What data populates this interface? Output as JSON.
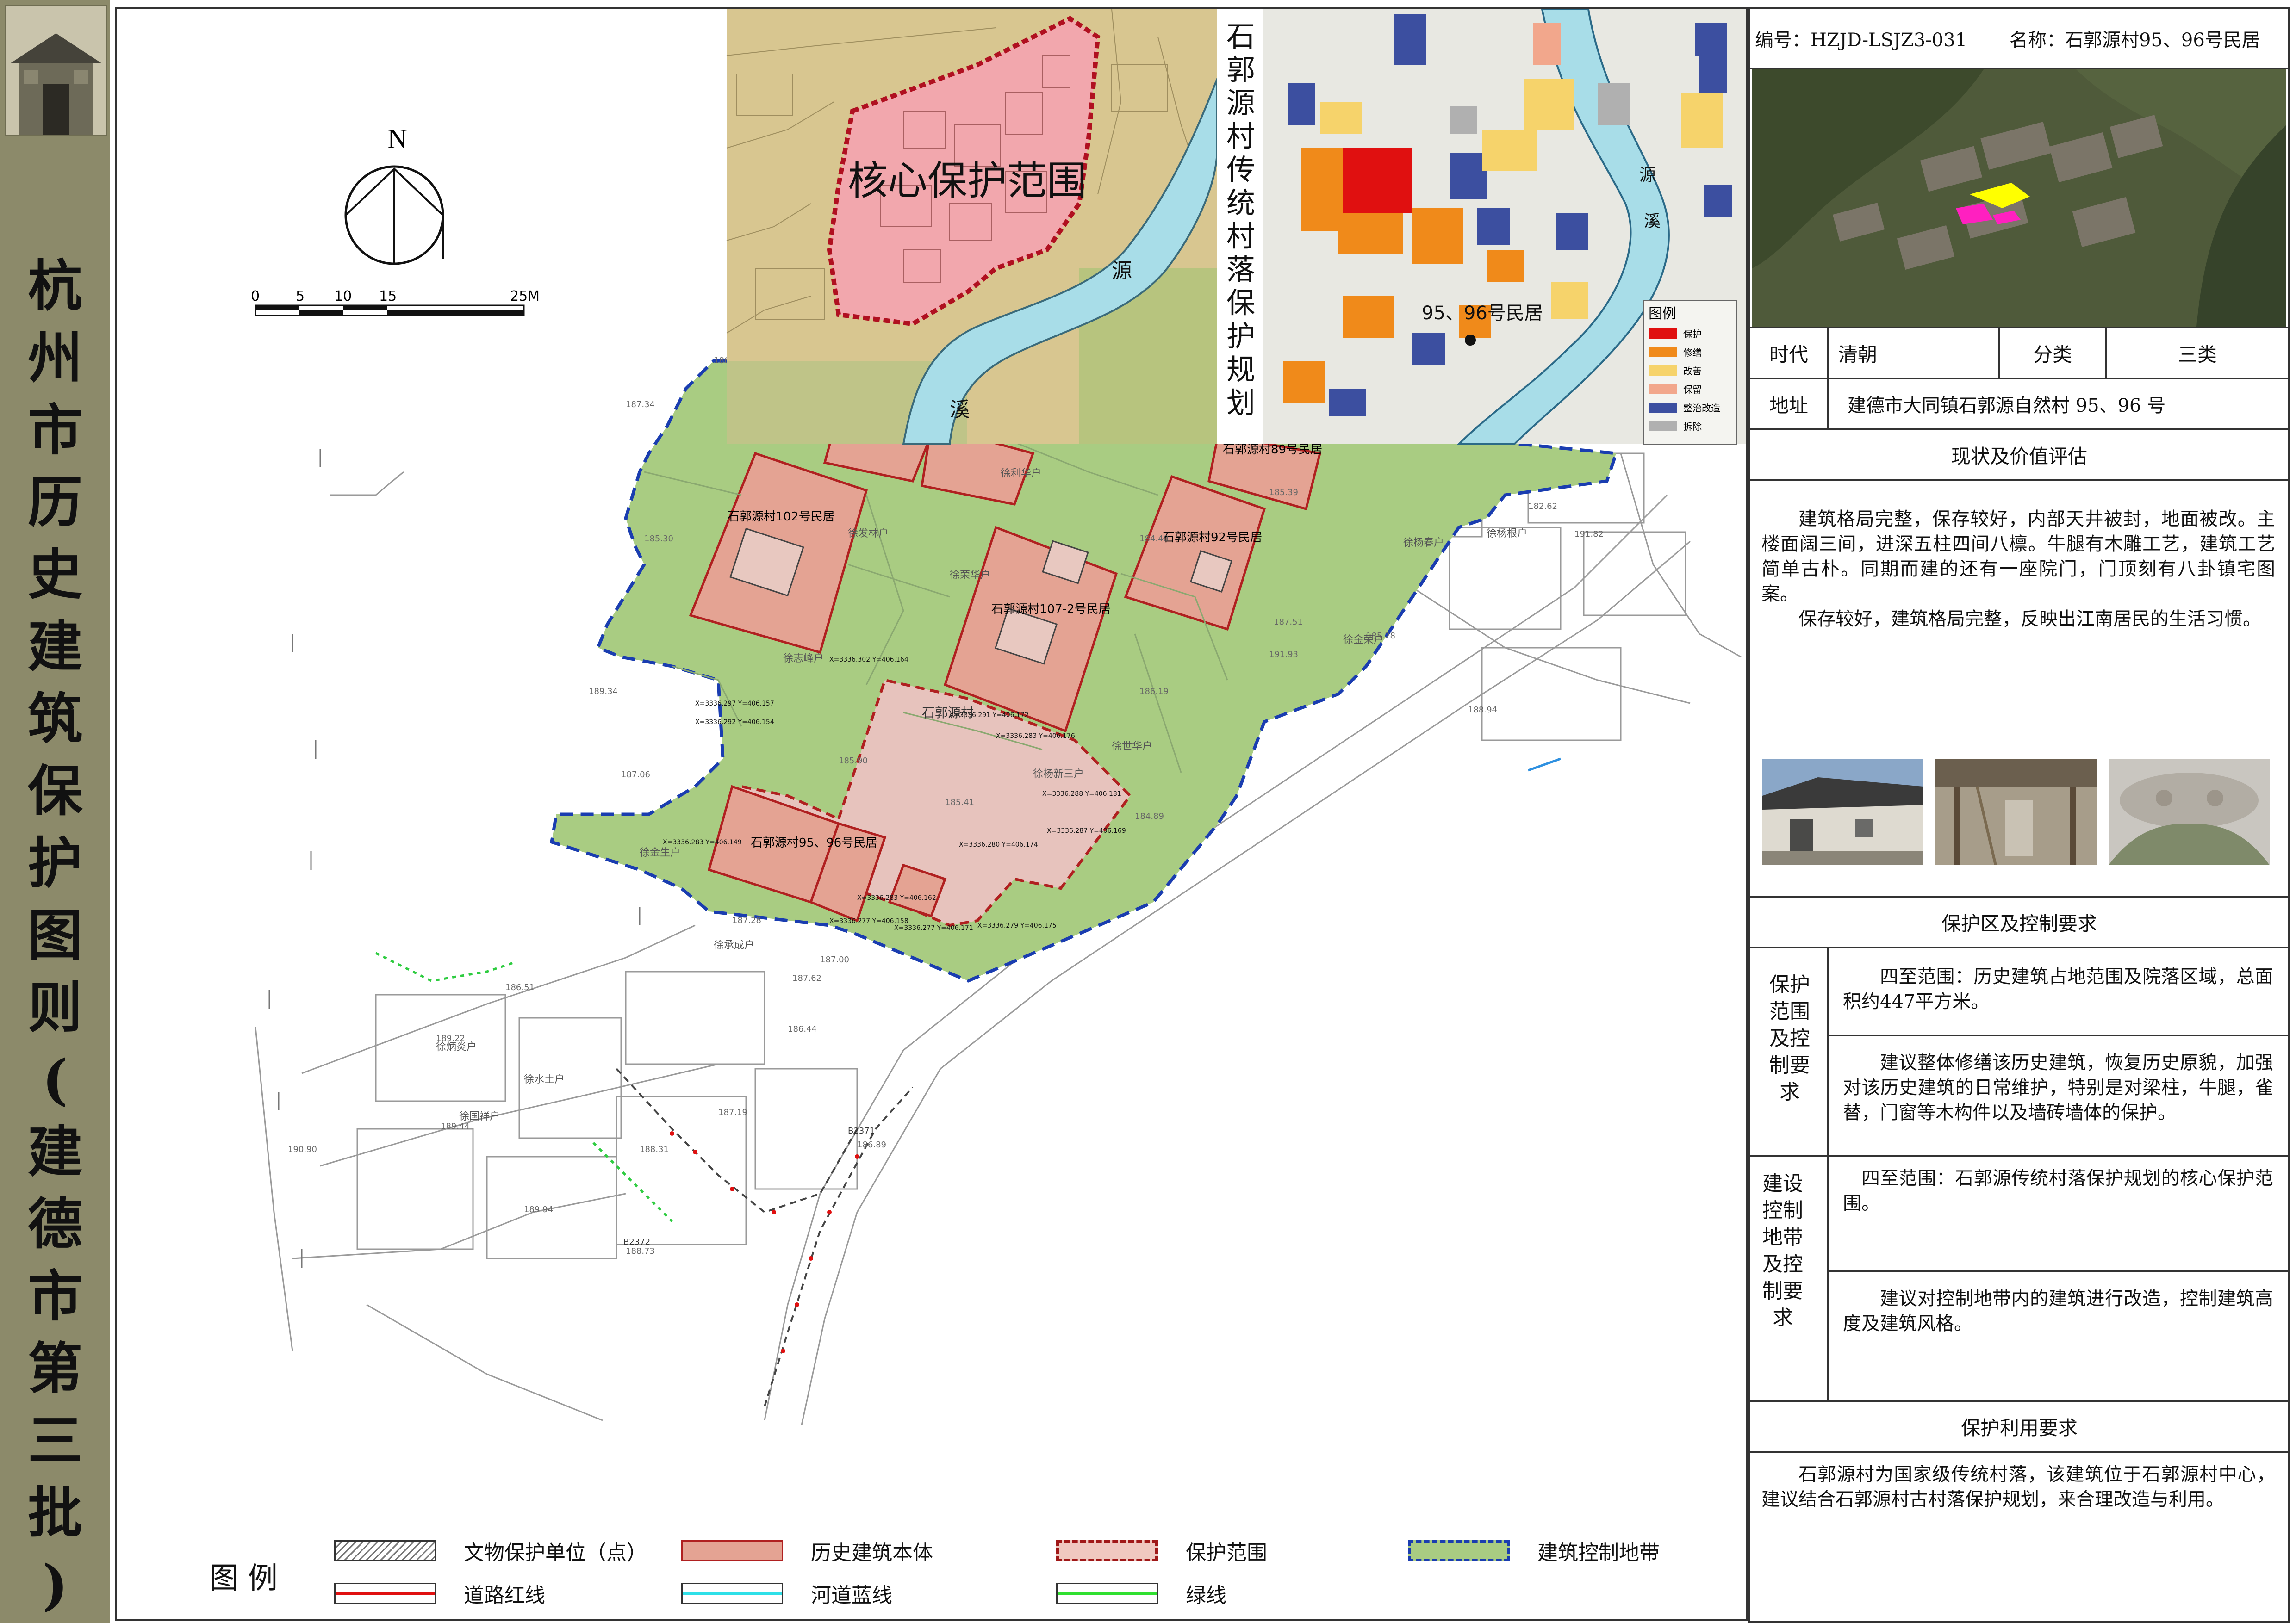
{
  "header": {
    "doc_no": "编号：HZJD-LSJZ3-031",
    "name": "名称：石郭源村95、96号民居"
  },
  "side_title": [
    "杭",
    "州",
    "市",
    "历",
    "史",
    "建",
    "筑",
    "保",
    "护",
    "图",
    "则",
    "(",
    "建",
    "德",
    "市",
    "第",
    "三",
    "批",
    ")"
  ],
  "map": {
    "north": "N",
    "scale_ticks": [
      "0",
      "5",
      "10",
      "15",
      "25M"
    ],
    "inset_core_label": "核心保护范围",
    "inset_creek_1": "源",
    "inset_creek_2": "溪",
    "inset_vertical_title": [
      "石",
      "郭",
      "源",
      "村",
      "传",
      "统",
      "村",
      "落",
      "保",
      "护",
      "规",
      "划"
    ],
    "inset2_house_label": "95、96号民居",
    "inset2_legend_title": "图例",
    "inset2_legend": [
      {
        "label": "保护",
        "color": "#e01010"
      },
      {
        "label": "修缮",
        "color": "#f08a1a"
      },
      {
        "label": "改善",
        "color": "#f6d36b"
      },
      {
        "label": "保留",
        "color": "#f2a78c"
      },
      {
        "label": "整治改造",
        "color": "#3c4fa0"
      },
      {
        "label": "拆除",
        "color": "#b0b0b0"
      }
    ],
    "inset2_creek": "源",
    "inset2_creek2": "溪",
    "buildings": {
      "b102": "石郭源村102号民居",
      "b107": "石郭源村107-2号民居",
      "b92": "石郭源村92号民居",
      "b89": "石郭源村89号民居",
      "b95": "石郭源村95、96号民居"
    },
    "village_label": "石郭源村",
    "small_labels": [
      "徐利华户",
      "徐发林户",
      "徐荣华户",
      "徐志峰户",
      "徐杨根户",
      "徐金生户",
      "徐炳炎户",
      "徐水土户",
      "徐国祥户",
      "徐杨春户",
      "徐金荣户",
      "徐世华户",
      "徐杨新三户",
      "徐承成户"
    ],
    "coords": [
      "X=3336.302 Y=406.164",
      "X=3336.297 Y=406.157",
      "X=3336.292 Y=406.154",
      "X=3336.291 Y=406.172",
      "X=3336.283 Y=406.176",
      "X=3336.288 Y=406.181",
      "X=3336.287 Y=406.169",
      "X=3336.280 Y=406.174",
      "X=3336.283 Y=406.149",
      "X=3336.283 Y=406.162",
      "X=3336.277 Y=406.158",
      "X=3336.277 Y=406.171",
      "X=3336.279 Y=406.175"
    ],
    "elevations": [
      "187.34",
      "186.71",
      "189.34",
      "187.06",
      "187.28",
      "187.62",
      "187.00",
      "186.51",
      "189.22",
      "186.44",
      "189.44",
      "190.90",
      "188.31",
      "187.19",
      "189.94",
      "186.89",
      "188.73",
      "185.90",
      "185.41",
      "184.89",
      "191.93",
      "188.94",
      "185.28",
      "191.82",
      "182.62",
      "187.51",
      "184.40",
      "185.39",
      "185.30",
      "186.19"
    ],
    "benchmarks": [
      "B2371",
      "B2372"
    ]
  },
  "legend": {
    "title": "图例",
    "items": [
      {
        "label": "文物保护单位（点）",
        "type": "hatch"
      },
      {
        "label": "历史建筑本体",
        "type": "fill",
        "color": "#e4a393"
      },
      {
        "label": "保护范围",
        "type": "dash-red",
        "color": "#f0c8c0"
      },
      {
        "label": "建筑控制地带",
        "type": "dash-blue",
        "color": "#a9cc82"
      },
      {
        "label": "道路红线",
        "type": "line",
        "color": "#e01010"
      },
      {
        "label": "河道蓝线",
        "type": "line",
        "color": "#2fe0e8"
      },
      {
        "label": "绿线",
        "type": "line",
        "color": "#30e030"
      }
    ]
  },
  "panel": {
    "era_label": "时代",
    "era_value": "清朝",
    "class_label": "分类",
    "class_value": "三类",
    "address_label": "地址",
    "address_value": "建德市大同镇石郭源自然村 95、96 号",
    "status_heading": "现状及价值评估",
    "status_p1": "建筑格局完整，保存较好，内部天井被封，地面被改。主楼面阔三间，进深五柱四间八檩。牛腿有木雕工艺，建筑工艺简单古朴。同期而建的还有一座院门，门顶刻有八卦镇宅图案。",
    "status_p2": "保存较好，建筑格局完整，反映出江南居民的生活习惯。",
    "zone_heading": "保护区及控制要求",
    "prot_label": "保护范围及控制要求",
    "prot_p1": "四至范围：历史建筑占地范围及院落区域，总面积约447平方米。",
    "prot_p2": "建议整体修缮该历史建筑，恢复历史原貌，加强对该历史建筑的日常维护，特别是对梁柱，牛腿，雀替，门窗等木构件以及墙砖墙体的保护。",
    "ctrl_label": "建设控制地带及控制要求",
    "ctrl_p1": "四至范围：石郭源传统村落保护规划的核心保护范围。",
    "ctrl_p2": "建议对控制地带内的建筑进行改造，控制建筑高度及建筑风格。",
    "use_heading": "保护利用要求",
    "use_p": "石郭源村为国家级传统村落，该建筑位于石郭源村中心，建议结合石郭源村古村落保护规划，来合理改造与利用。"
  },
  "colors": {
    "historic_building": "#e4a393",
    "protection_range": "#edc4bd",
    "control_zone": "#a9cc82",
    "side_band": "#8c8a6a"
  }
}
